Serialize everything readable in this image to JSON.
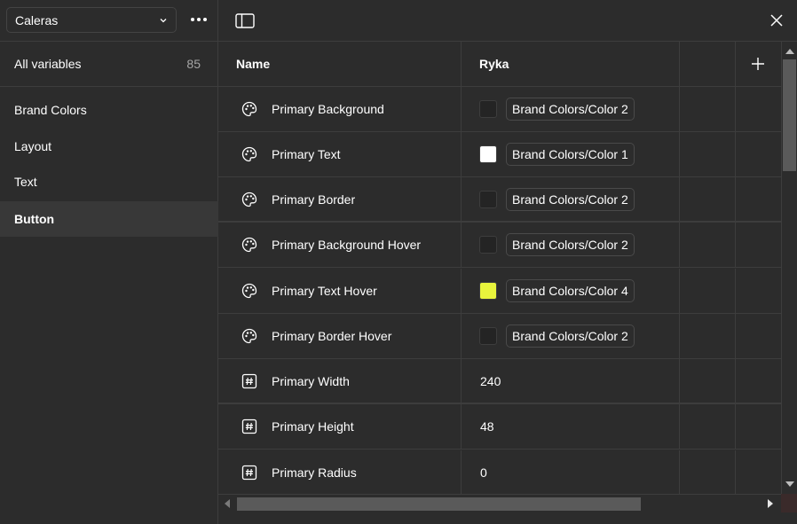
{
  "sidebar": {
    "collection": "Caleras",
    "all_variables_label": "All variables",
    "all_variables_count": "85",
    "groups": [
      "Brand Colors",
      "Layout",
      "Text",
      "Button"
    ],
    "active_group": "Button"
  },
  "table": {
    "name_header": "Name",
    "mode_header": "Ryka",
    "rows": [
      {
        "name": "Primary Background",
        "type": "color-icon",
        "swatch": "#242424",
        "value": "Brand Colors/Color 2"
      },
      {
        "name": "Primary Text",
        "type": "color-icon",
        "swatch": "#ffffff",
        "value": "Brand Colors/Color 1"
      },
      {
        "name": "Primary Border",
        "type": "color-icon",
        "swatch": "#242424",
        "value": "Brand Colors/Color 2"
      },
      {
        "name": "Primary Background Hover",
        "type": "color-icon",
        "swatch": "#242424",
        "value": "Brand Colors/Color 2"
      },
      {
        "name": "Primary Text Hover",
        "type": "color-icon",
        "swatch": "#e8f43c",
        "value": "Brand Colors/Color 4"
      },
      {
        "name": "Primary Border Hover",
        "type": "color-icon",
        "swatch": "#242424",
        "value": "Brand Colors/Color 2"
      },
      {
        "name": "Primary Width",
        "type": "number-icon",
        "value": "240"
      },
      {
        "name": "Primary Height",
        "type": "number-icon",
        "value": "48"
      },
      {
        "name": "Primary Radius",
        "type": "number-icon",
        "value": "0"
      }
    ]
  },
  "colors": {
    "background": "#2c2c2c",
    "border": "#3d3d3d",
    "active_row": "#383838",
    "accent_yellow": "#e8f43c"
  }
}
